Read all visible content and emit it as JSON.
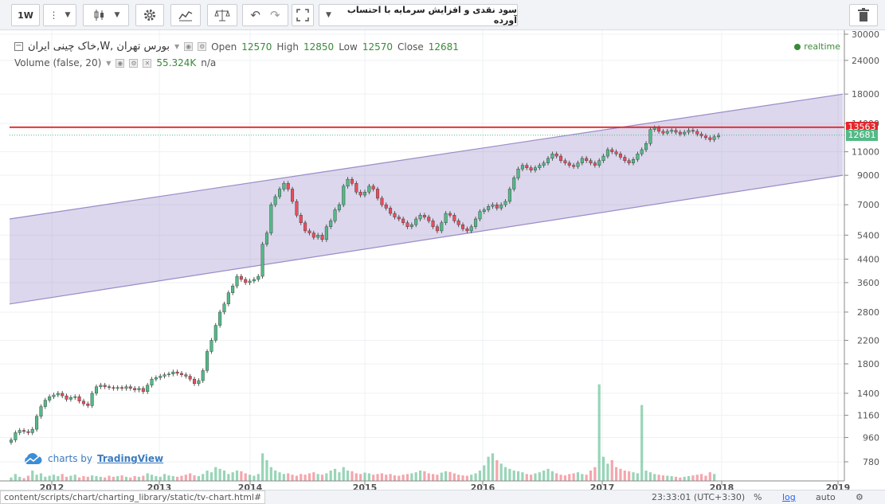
{
  "toolbar": {
    "interval": "1W",
    "study_label": "سود نقدی و افزایش سرمایه با احتساب آورده"
  },
  "legend": {
    "symbol": "بورس تهران ,W,خاک چینی ایران",
    "open_label": "Open",
    "open": "12570",
    "high_label": "High",
    "high": "12850",
    "low_label": "Low",
    "low": "12570",
    "close_label": "Close",
    "close": "12681",
    "volume_label": "Volume (false, 20)",
    "volume_value": "55.324K",
    "volume_na": "n/a"
  },
  "realtime": "realtime",
  "watermark": {
    "prefix": "charts by",
    "brand": "TradingView"
  },
  "price_tags": {
    "resistance": "13563",
    "last": "12681"
  },
  "statusbar": {
    "url": "content/scripts/chart/charting_library/static/tv-chart.html#",
    "time": "23:33:01 (UTC+3:30)",
    "percent": "%",
    "log": "log",
    "auto": "auto"
  },
  "colors": {
    "up": "#53b987",
    "down": "#eb4d5c",
    "channel": "#9b8bc8",
    "resistance": "#e5252a"
  },
  "chart_data": {
    "type": "candlestick",
    "log_scale": true,
    "x_labels": [
      "2012",
      "2013",
      "2014",
      "2015",
      "2016",
      "2017",
      "2018",
      "2019"
    ],
    "y_ticks": [
      30000,
      24000,
      18000,
      14000,
      11000,
      9000,
      7000,
      5400,
      4400,
      3600,
      2800,
      2200,
      1800,
      1400,
      1160,
      960,
      780
    ],
    "resistance": 13563,
    "last_close": 12681,
    "channel": {
      "upper_start": 6200,
      "upper_end": 18000,
      "lower_start": 3000,
      "lower_end": 9000
    },
    "closes": [
      940,
      1000,
      1020,
      1010,
      1000,
      1030,
      1150,
      1250,
      1320,
      1360,
      1380,
      1400,
      1370,
      1330,
      1350,
      1360,
      1310,
      1280,
      1260,
      1400,
      1480,
      1500,
      1480,
      1470,
      1460,
      1470,
      1460,
      1480,
      1460,
      1440,
      1460,
      1420,
      1500,
      1580,
      1600,
      1620,
      1640,
      1650,
      1680,
      1660,
      1640,
      1620,
      1580,
      1520,
      1560,
      1700,
      2000,
      2200,
      2500,
      2800,
      3000,
      3300,
      3500,
      3800,
      3700,
      3600,
      3650,
      3700,
      3800,
      5000,
      5500,
      7000,
      7500,
      8000,
      8400,
      8000,
      7200,
      6400,
      6000,
      5600,
      5500,
      5300,
      5400,
      5200,
      5800,
      6100,
      6700,
      7000,
      8200,
      8700,
      8400,
      7800,
      7600,
      7800,
      8200,
      8000,
      7400,
      7000,
      6800,
      6500,
      6300,
      6200,
      6000,
      5800,
      5900,
      6200,
      6400,
      6300,
      6100,
      5800,
      5600,
      6000,
      6500,
      6400,
      6100,
      5900,
      5700,
      5600,
      5800,
      6200,
      6600,
      6700,
      6900,
      7000,
      6800,
      7000,
      7200,
      8000,
      8800,
      9500,
      9800,
      9600,
      9400,
      9600,
      9800,
      10000,
      10400,
      10800,
      10600,
      10200,
      10000,
      9800,
      9700,
      10000,
      10400,
      10200,
      10000,
      9800,
      10200,
      10600,
      11200,
      11000,
      10800,
      10500,
      10200,
      10000,
      10300,
      10800,
      11200,
      11800,
      13300,
      13500,
      13100,
      12900,
      13100,
      13200,
      13000,
      12800,
      13000,
      13200,
      13100,
      12800,
      12600,
      12400,
      12200,
      12500,
      12681
    ],
    "volumes_k": [
      10,
      20,
      12,
      8,
      15,
      30,
      18,
      22,
      12,
      15,
      18,
      14,
      20,
      12,
      15,
      18,
      10,
      14,
      12,
      16,
      14,
      12,
      10,
      15,
      12,
      14,
      16,
      12,
      10,
      14,
      12,
      15,
      22,
      18,
      14,
      12,
      20,
      16,
      14,
      12,
      15,
      18,
      22,
      16,
      14,
      20,
      30,
      25,
      40,
      35,
      30,
      20,
      25,
      30,
      28,
      22,
      18,
      15,
      20,
      80,
      60,
      40,
      30,
      25,
      20,
      22,
      18,
      15,
      20,
      18,
      22,
      25,
      20,
      18,
      22,
      30,
      35,
      25,
      40,
      30,
      28,
      22,
      20,
      24,
      22,
      18,
      20,
      22,
      18,
      20,
      16,
      15,
      18,
      20,
      22,
      25,
      30,
      28,
      22,
      20,
      18,
      24,
      28,
      26,
      22,
      18,
      16,
      15,
      18,
      22,
      30,
      45,
      70,
      80,
      60,
      50,
      40,
      35,
      30,
      28,
      25,
      20,
      18,
      22,
      25,
      30,
      35,
      28,
      22,
      18,
      16,
      20,
      22,
      25,
      20,
      18,
      30,
      40,
      280,
      70,
      50,
      60,
      40,
      35,
      30,
      28,
      25,
      22,
      220,
      30,
      25,
      20,
      18,
      16,
      15,
      14,
      12,
      10,
      12,
      14,
      16,
      18,
      20,
      15,
      25,
      20
    ]
  }
}
